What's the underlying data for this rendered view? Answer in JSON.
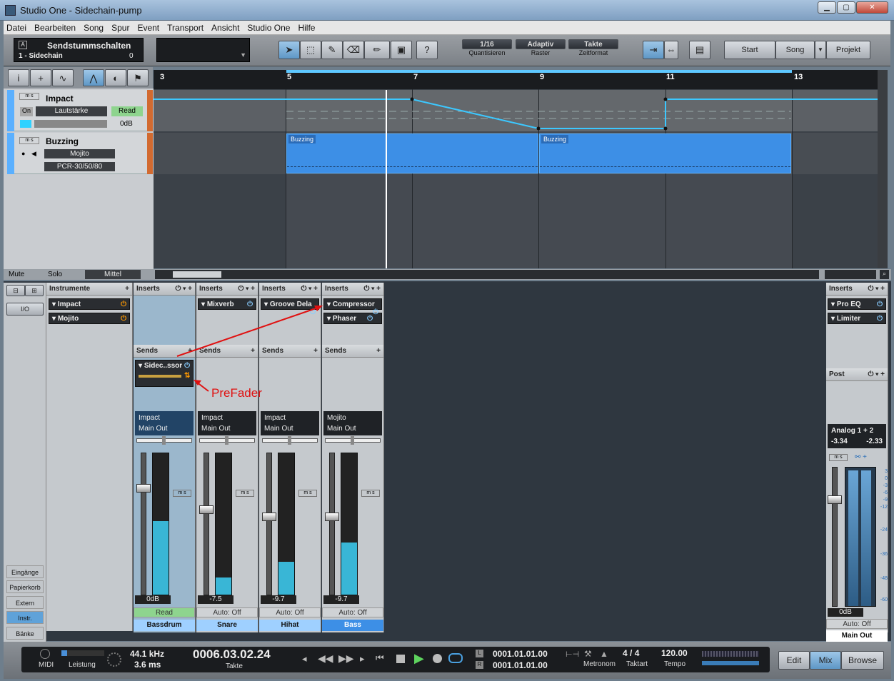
{
  "window": {
    "title": "Studio One - Sidechain-pump"
  },
  "menu": [
    "Datei",
    "Bearbeiten",
    "Song",
    "Spur",
    "Event",
    "Transport",
    "Ansicht",
    "Studio One",
    "Hilfe"
  ],
  "toolbar": {
    "macro_title": "Sendstummschalten",
    "macro_sub": "1 - Sidechain",
    "macro_val": "0",
    "quantize": "1/16",
    "quantize_lbl": "Quantisieren",
    "snap": "Adaptiv",
    "snap_lbl": "Raster",
    "timeformat": "Takte",
    "timeformat_lbl": "Zeitformat",
    "start": "Start",
    "song": "Song",
    "projekt": "Projekt",
    "help": "?"
  },
  "ruler": [
    "3",
    "5",
    "7",
    "9",
    "11",
    "13"
  ],
  "tracks": [
    {
      "name": "Impact",
      "on": "On",
      "param": "Lautstärke",
      "mode": "Read",
      "db": "0dB"
    },
    {
      "name": "Buzzing",
      "instrument": "Mojito",
      "output": "PCR-30/50/80"
    }
  ],
  "parts": [
    "Buzzing",
    "Buzzing"
  ],
  "arrange_footer": {
    "mute": "Mute",
    "solo": "Solo",
    "mittel": "Mittel"
  },
  "console": {
    "extern": "Extern",
    "io": "I/O",
    "instruments_hdr": "Instrumente",
    "instruments": [
      "Impact",
      "Mojito"
    ],
    "side_buttons": [
      "Eingänge",
      "Papierkorb",
      "Extern",
      "Instr.",
      "Bänke"
    ],
    "inserts_lbl": "Inserts",
    "sends_lbl": "Sends",
    "channels": [
      {
        "inserts": [],
        "send": "Sidec..ssor",
        "in": "Impact",
        "out": "Main Out",
        "val": "0dB",
        "mode": "Read",
        "name": "Bassdrum",
        "level": 0.52
      },
      {
        "inserts": [
          "Mixverb"
        ],
        "in": "Impact",
        "out": "Main Out",
        "val": "-7.5",
        "mode": "Auto: Off",
        "name": "Snare",
        "level": 0.12
      },
      {
        "inserts": [
          "Groove Dela"
        ],
        "in": "Impact",
        "out": "Main Out",
        "val": "-9.7",
        "mode": "Auto: Off",
        "name": "Hihat",
        "level": 0.23
      },
      {
        "inserts": [
          "Compressor",
          "Phaser"
        ],
        "in": "Mojito",
        "out": "Main Out",
        "val": "-9.7",
        "mode": "Auto: Off",
        "name": "Bass",
        "level": 0.37
      }
    ],
    "annotation": "PreFader",
    "master": {
      "inserts": [
        "Pro EQ",
        "Limiter"
      ],
      "post": "Post",
      "io": "Analog 1 + 2",
      "peakL": "-3.34",
      "peakR": "-2.33",
      "val": "0dB",
      "mode": "Auto: Off",
      "name": "Main Out",
      "scale": [
        "3",
        "0",
        "-3",
        "-6",
        "-9",
        "-12",
        "-24",
        "-36",
        "-48",
        "-60"
      ]
    }
  },
  "transport": {
    "midi": "MIDI",
    "leistung": "Leistung",
    "rate": "44.1 kHz",
    "latency": "3.6 ms",
    "pos": "0006.03.02.24",
    "pos_lbl": "Takte",
    "L": "0001.01.01.00",
    "R": "0001.01.01.00",
    "metronom": "Metronom",
    "sig_num": "4",
    "sig_den": "4",
    "taktart": "Taktart",
    "tempo": "120.00",
    "tempo_lbl": "Tempo",
    "edit": "Edit",
    "mix": "Mix",
    "browse": "Browse"
  }
}
